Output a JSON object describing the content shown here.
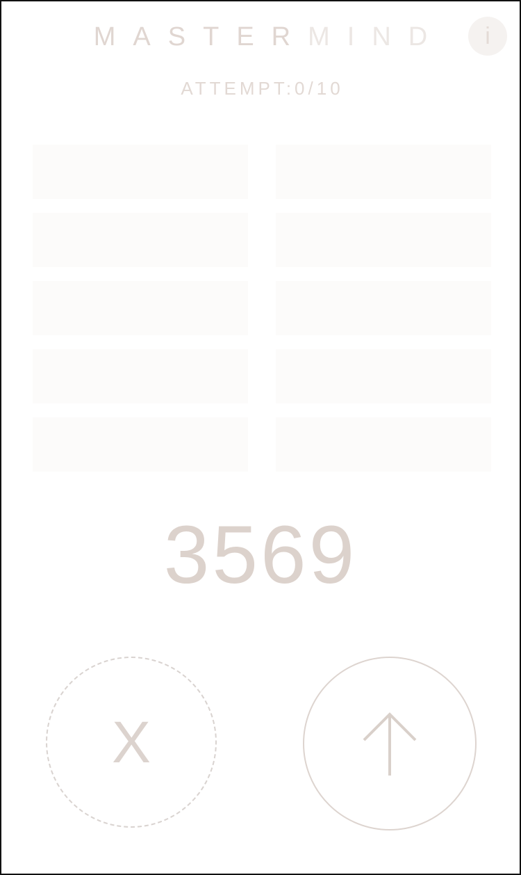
{
  "header": {
    "title_part_a": "MASTER",
    "title_part_b": "MIND",
    "info_label": "i",
    "attempt_text": "ATTEMPT:0/10"
  },
  "board": {
    "slots": [
      "",
      "",
      "",
      "",
      "",
      "",
      "",
      "",
      "",
      ""
    ]
  },
  "input": {
    "current_guess": "3569"
  },
  "controls": {
    "clear_label": "X",
    "submit_icon": "arrow-up-icon"
  },
  "colors": {
    "title_primary": "#e0d6d1",
    "title_secondary": "#ece7e4",
    "slot_fill": "#fcfbfa",
    "guess_text": "#dcd2cc",
    "button_border": "#ddd4cf"
  }
}
